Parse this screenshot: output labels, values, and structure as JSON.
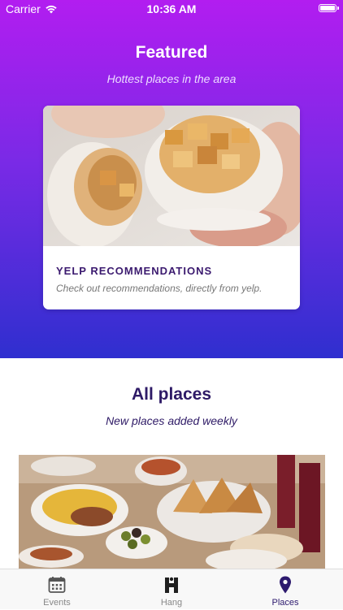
{
  "status_bar": {
    "carrier": "Carrier",
    "time": "10:36 AM"
  },
  "featured": {
    "title": "Featured",
    "subtitle": "Hottest places in the area",
    "card": {
      "title": "YELP RECOMMENDATIONS",
      "description": "Check out recommendations, directly from yelp."
    }
  },
  "all_places": {
    "title": "All places",
    "subtitle": "New places added weekly"
  },
  "tab_bar": {
    "tabs": [
      {
        "label": "Events",
        "icon": "calendar-icon",
        "active": false
      },
      {
        "label": "Hang",
        "icon": "hang-logo-icon",
        "active": false
      },
      {
        "label": "Places",
        "icon": "location-pin-icon",
        "active": true
      }
    ]
  },
  "colors": {
    "gradient_top": "#b21df0",
    "gradient_bottom": "#2f2fcf",
    "accent_dark": "#2d1a6e"
  }
}
